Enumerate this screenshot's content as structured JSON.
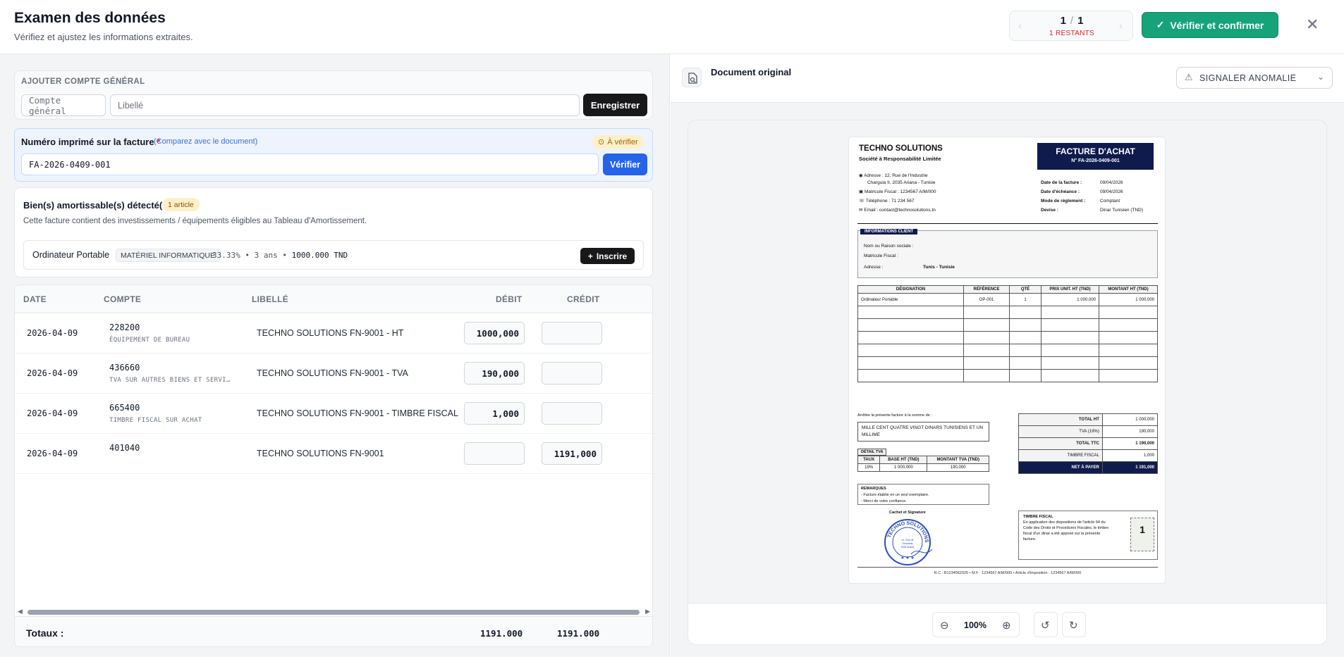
{
  "header": {
    "title": "Examen des données",
    "subtitle": "Vérifiez et ajustez les informations extraites.",
    "pager_current": "1",
    "pager_sep": "/",
    "pager_total": "1",
    "pager_remaining": "1 RESTANTS",
    "confirm_label": "Vérifier et confirmer",
    "confirm_color": "#16a37a"
  },
  "add_account": {
    "section_label": "AJOUTER COMPTE GÉNÉRAL",
    "account_placeholder": "Compte général",
    "label_placeholder": "Libellé",
    "save_label": "Enregistrer"
  },
  "invoice_number": {
    "label": "Numéro imprimé sur la facture",
    "required_mark": "*",
    "compare_hint": "(Comparez avec le document)",
    "status_badge": "À vérifier",
    "value": "FA-2026-0409-001",
    "verify_label": "Vérifier"
  },
  "assets": {
    "title": "Bien(s) amortissable(s) détecté(s)",
    "count_badge": "1 article",
    "description": "Cette facture contient des investissements / équipements éligibles au Tableau d'Amortissement.",
    "item_name": "Ordinateur Portable",
    "item_category": "MATÉRIEL INFORMATIQUE",
    "item_rate": "33.33%",
    "item_duration": "3 ans",
    "item_amount": "1000.000 TND",
    "register_label": "Inscrire"
  },
  "journal": {
    "headers": {
      "date": "DATE",
      "account": "COMPTE",
      "label": "LIBELLÉ",
      "debit": "DÉBIT",
      "credit": "CRÉDIT"
    },
    "rows": [
      {
        "date": "2026-04-09",
        "account": "228200",
        "account_name": "ÉQUIPEMENT DE BUREAU",
        "label": "TECHNO SOLUTIONS FN-9001 - HT",
        "debit": "1000,000",
        "credit": ""
      },
      {
        "date": "2026-04-09",
        "account": "436660",
        "account_name": "TVA SUR AUTRES BIENS ET SERVI…",
        "label": "TECHNO SOLUTIONS FN-9001 - TVA",
        "debit": "190,000",
        "credit": ""
      },
      {
        "date": "2026-04-09",
        "account": "665400",
        "account_name": "TIMBRE FISCAL SUR ACHAT",
        "label": "TECHNO SOLUTIONS FN-9001 - TIMBRE FISCAL",
        "debit": "1,000",
        "credit": ""
      },
      {
        "date": "2026-04-09",
        "account": "401040",
        "account_name": "",
        "label": "TECHNO SOLUTIONS FN-9001",
        "debit": "",
        "credit": "1191,000"
      }
    ],
    "totals_label": "Totaux :",
    "total_debit": "1191.000",
    "total_credit": "1191.000"
  },
  "document": {
    "title": "Document original",
    "anomaly_label": "SIGNALER ANOMALIE",
    "zoom": "100%"
  },
  "invoice": {
    "company": "TECHNO SOLUTIONS",
    "company_type": "Société à Responsabilité Limitée",
    "address_line1": "Adresse : 12, Rue de l'Industrie",
    "address_line2": "Charguia II, 2035 Ariana - Tunisie",
    "tax_id": "Matricule Fiscal : 1234567 A/M/000",
    "phone": "Téléphone : 71 234 567",
    "email": "Email : contact@technosolutions.tn",
    "doc_type": "FACTURE D'ACHAT",
    "doc_number": "N° FA-2026-0409-001",
    "meta": [
      {
        "k": "Date de la facture :",
        "v": "09/04/2026"
      },
      {
        "k": "Date d'échéance :",
        "v": "09/04/2026"
      },
      {
        "k": "Mode de règlement :",
        "v": "Comptant"
      },
      {
        "k": "Devise :",
        "v": "Dinar Tunisien (TND)"
      }
    ],
    "client_tab": "INFORMATIONS CLIENT",
    "client_name": "Nom ou Raison sociale :",
    "client_tax": "Matricule Fiscal :",
    "client_address": "Adresse :",
    "client_address_value": "Tunis - Tunisie",
    "cols": [
      "DÉSIGNATION",
      "RÉFÉRENCE",
      "QTÉ",
      "PRIX UNIT. HT (TND)",
      "MONTANT HT (TND)"
    ],
    "line": [
      "Ordinateur Portable",
      "OP-001",
      "1",
      "1 000,000",
      "1 000,000"
    ],
    "amount_intro": "Arrêtée la présente facture à la somme de :",
    "amount_words": "MILLE CENT QUATRE VINGT DINARS TUNISIENS ET UN MILLIME",
    "vat_tab": "DÉTAIL TVA",
    "vat_cols": [
      "TAUX",
      "BASE HT (TND)",
      "MONTANT TVA (TND)"
    ],
    "vat_row": [
      "19%",
      "1 000,000",
      "190,000"
    ],
    "totals": [
      {
        "k": "TOTAL HT",
        "v": "1 000,000"
      },
      {
        "k": "TVA (19%)",
        "v": "190,000"
      },
      {
        "k": "TOTAL TTC",
        "v": "1 190,000"
      },
      {
        "k": "TIMBRE FISCAL",
        "v": "1,000"
      }
    ],
    "net_label": "NET À PAYER",
    "net_value": "1 191,000",
    "remarks_title": "REMARQUES",
    "remark1": "- Facture établie en un seul exemplaire.",
    "remark2": "- Merci de votre confiance.",
    "stamp_title": "Cachet et Signature",
    "stamp_ring_text": "TECHNO SOLUTIONS",
    "stamp_inner_text": "12, Rue de l'Industrie Charguia II 2035 Ariana TUNISIE",
    "fiscal_title": "TIMBRE FISCAL",
    "fiscal_text": "En application des dispositions de l'article 64 du Code des Droits et Procédures Fiscales, le timbre fiscal d'un dinar a été apposé sur la présente facture.",
    "fiscal_stamp_value": "1",
    "footer": "R.C : B1234562026   •   M.F : 1234567 A/M/000   •   Article d'imposition : 1234567 A/M/000"
  }
}
